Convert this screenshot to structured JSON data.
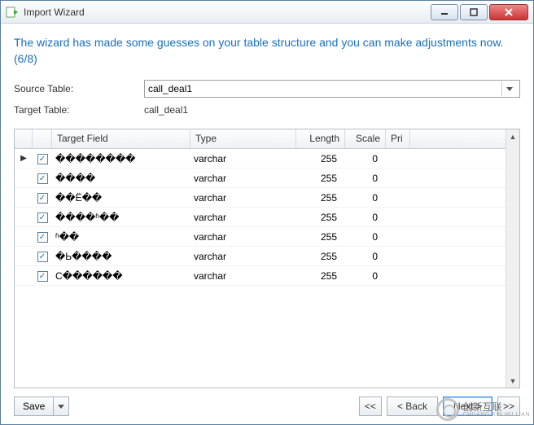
{
  "window": {
    "title": "Import Wizard"
  },
  "heading": "The wizard has made some guesses on your table structure and you can make adjustments now. (6/8)",
  "form": {
    "source_label": "Source Table:",
    "source_value": "call_deal1",
    "target_label": "Target Table:",
    "target_value": "call_deal1"
  },
  "table": {
    "columns": {
      "handle": "",
      "chk": "",
      "field": "Target Field",
      "type": "Type",
      "length": "Length",
      "scale": "Scale",
      "pri": "Pri"
    },
    "rows": [
      {
        "pointer": true,
        "checked": true,
        "field": "��������",
        "type": "varchar",
        "length": "255",
        "scale": "0"
      },
      {
        "pointer": false,
        "checked": true,
        "field": "����",
        "type": "varchar",
        "length": "255",
        "scale": "0"
      },
      {
        "pointer": false,
        "checked": true,
        "field": "��Ë��",
        "type": "varchar",
        "length": "255",
        "scale": "0"
      },
      {
        "pointer": false,
        "checked": true,
        "field": "����ʱ��",
        "type": "varchar",
        "length": "255",
        "scale": "0"
      },
      {
        "pointer": false,
        "checked": true,
        "field": "ʱ��",
        "type": "varchar",
        "length": "255",
        "scale": "0"
      },
      {
        "pointer": false,
        "checked": true,
        "field": "�Ь����",
        "type": "varchar",
        "length": "255",
        "scale": "0"
      },
      {
        "pointer": false,
        "checked": true,
        "field": "C������",
        "type": "varchar",
        "length": "255",
        "scale": "0"
      }
    ]
  },
  "footer": {
    "save": "Save",
    "first": "<<",
    "back": "<   Back",
    "next": "Next   >",
    "last": ">>"
  },
  "watermark": {
    "cn": "创新互联",
    "en": "CHUANG XIN HU LIAN"
  }
}
